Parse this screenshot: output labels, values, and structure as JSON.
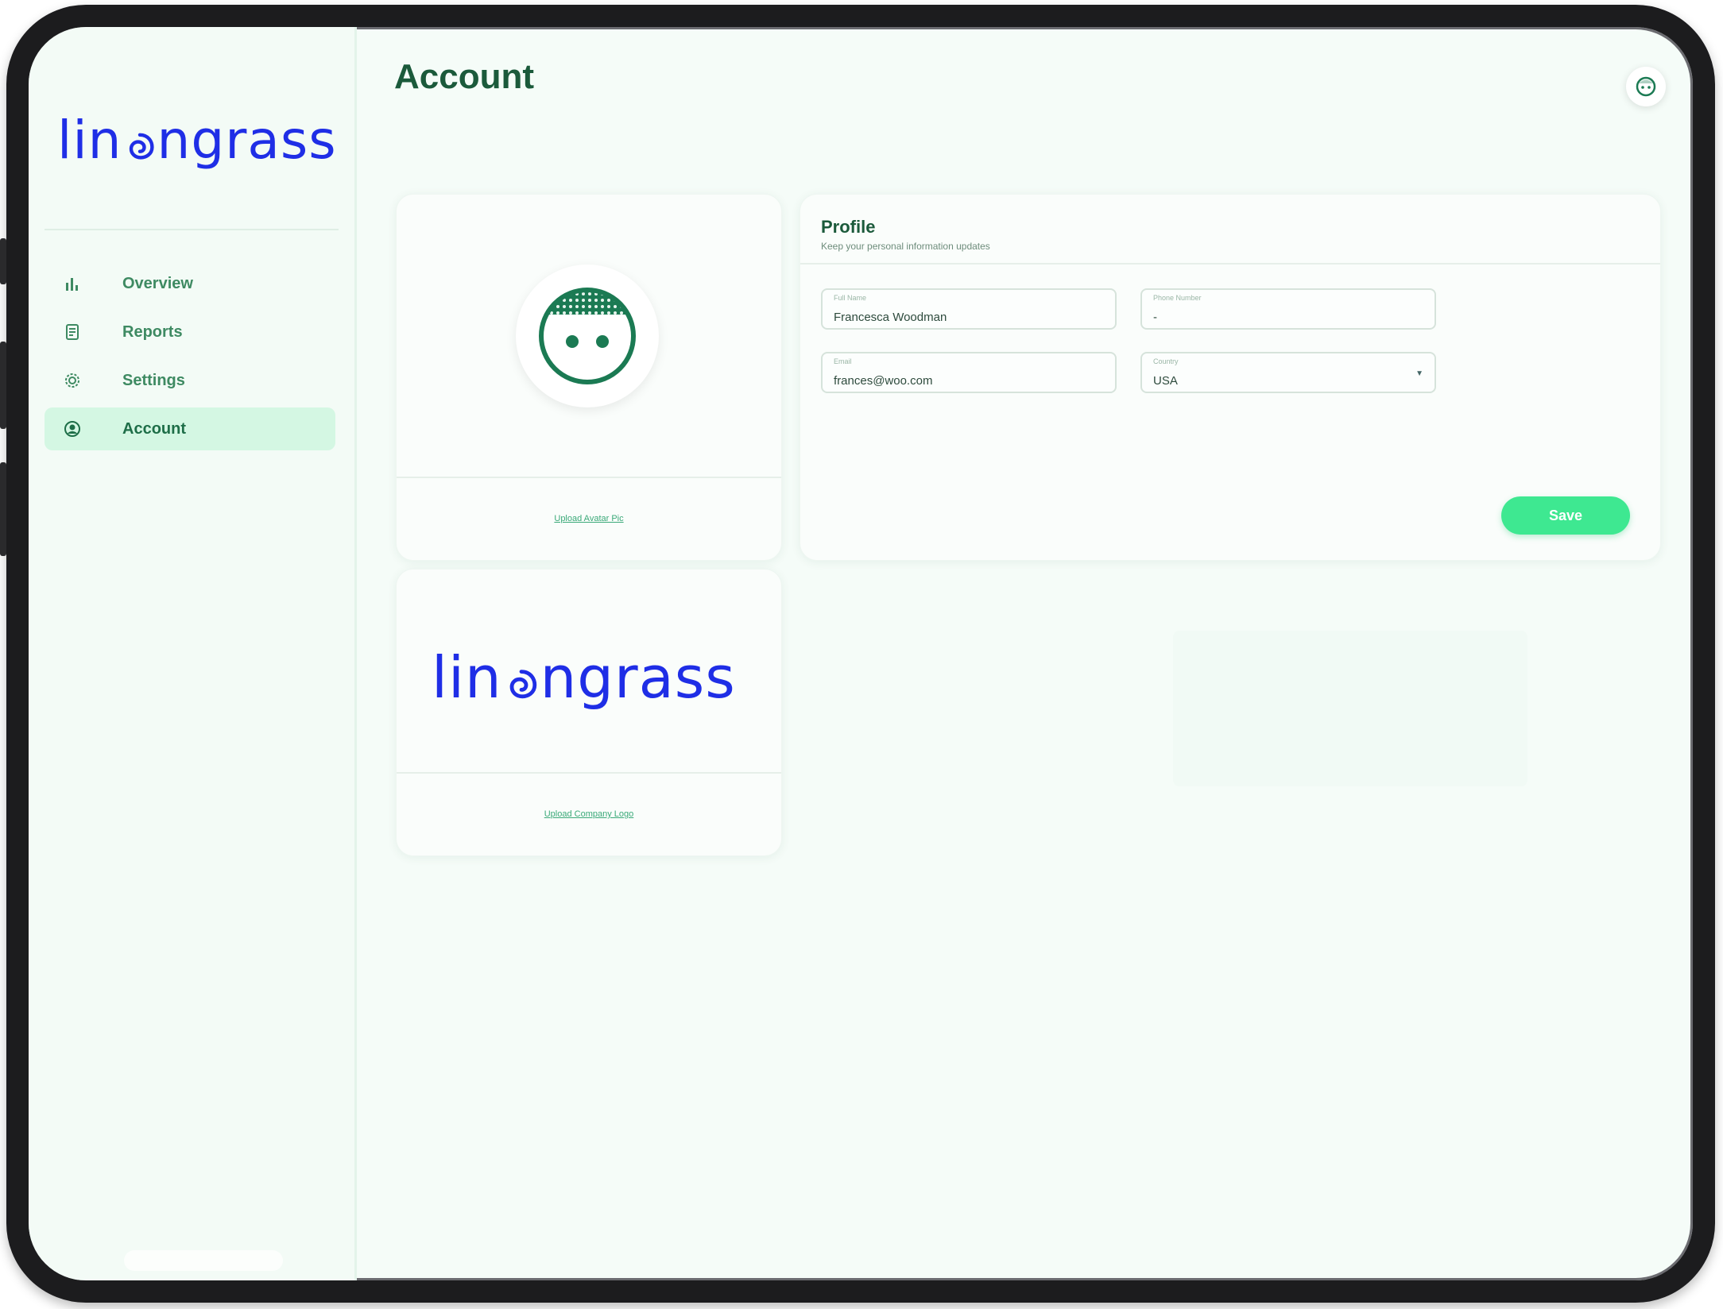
{
  "brand": {
    "name": "linengrass",
    "accent_color": "#1f2ee6",
    "green": "#3ee891"
  },
  "sidebar": {
    "items": [
      {
        "label": "Overview",
        "icon": "bar-chart-icon",
        "active": false
      },
      {
        "label": "Reports",
        "icon": "document-icon",
        "active": false
      },
      {
        "label": "Settings",
        "icon": "gear-icon",
        "active": false
      },
      {
        "label": "Account",
        "icon": "user-circle-icon",
        "active": true
      }
    ]
  },
  "header": {
    "title": "Account",
    "avatar_icon": "face-avatar-icon"
  },
  "avatar_card": {
    "upload_label": "Upload Avatar Pic"
  },
  "logo_card": {
    "logo_text": "linengrass",
    "upload_label": "Upload Company Logo"
  },
  "profile": {
    "title": "Profile",
    "subtitle": "Keep your personal information updates",
    "fields": {
      "full_name": {
        "label": "Full Name",
        "value": "Francesca Woodman"
      },
      "phone": {
        "label": "Phone Number",
        "value": "-"
      },
      "email": {
        "label": "Email",
        "value": "frances@woo.com"
      },
      "country": {
        "label": "Country",
        "value": "USA"
      }
    },
    "save_label": "Save"
  }
}
